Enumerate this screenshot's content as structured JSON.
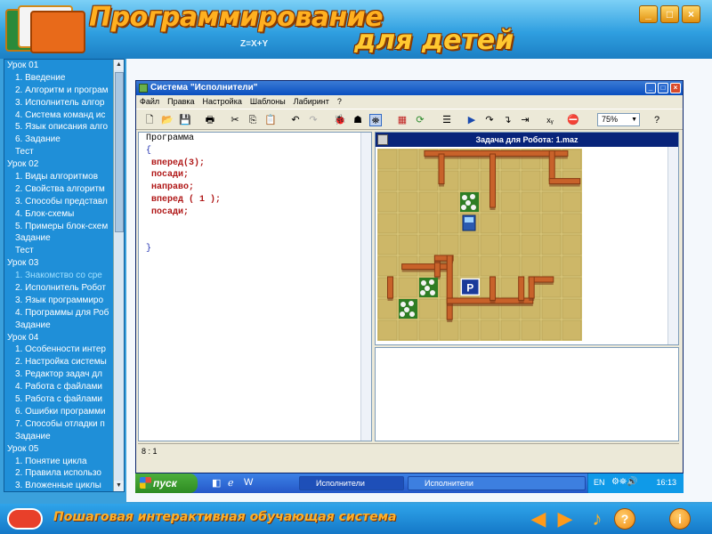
{
  "app": {
    "title_main": "Программирование",
    "title_sub": "для детей",
    "header_decor_formula": "Z=X+Y",
    "window_controls": {
      "minimize": "_",
      "maximize": "□",
      "close": "×"
    },
    "footer_text": "Пошаговая интерактивная обучающая система",
    "footer_buttons": {
      "back": "◀",
      "forward": "▶",
      "music": "♪",
      "help": "?",
      "info": "i"
    }
  },
  "lessons": [
    {
      "label": "Урок 01",
      "level": "h"
    },
    {
      "label": "1. Введение",
      "level": "s"
    },
    {
      "label": "2. Алгоритм и програм",
      "level": "s"
    },
    {
      "label": "3. Исполнитель алгор",
      "level": "s"
    },
    {
      "label": "4. Система команд ис",
      "level": "s"
    },
    {
      "label": "5. Язык описания алго",
      "level": "s"
    },
    {
      "label": "6. Задание",
      "level": "s"
    },
    {
      "label": "Тест",
      "level": "s"
    },
    {
      "label": "Урок 02",
      "level": "h"
    },
    {
      "label": "1. Виды алгоритмов",
      "level": "s"
    },
    {
      "label": "2. Свойства алгоритм",
      "level": "s"
    },
    {
      "label": "3. Способы представл",
      "level": "s"
    },
    {
      "label": "4. Блок-схемы",
      "level": "s"
    },
    {
      "label": "5. Примеры блок-схем",
      "level": "s"
    },
    {
      "label": "Задание",
      "level": "s"
    },
    {
      "label": "Тест",
      "level": "s"
    },
    {
      "label": "Урок 03",
      "level": "h"
    },
    {
      "label": "1. Знакомство со сре",
      "level": "s",
      "active": true
    },
    {
      "label": "2. Исполнитель Робот",
      "level": "s"
    },
    {
      "label": "3. Язык программиро",
      "level": "s"
    },
    {
      "label": "4. Программы для Роб",
      "level": "s"
    },
    {
      "label": "Задание",
      "level": "s"
    },
    {
      "label": "Урок 04",
      "level": "h"
    },
    {
      "label": "1. Особенности интер",
      "level": "s"
    },
    {
      "label": "2. Настройка системы",
      "level": "s"
    },
    {
      "label": "3. Редактор задач дл",
      "level": "s"
    },
    {
      "label": "4. Работа с файлами",
      "level": "s"
    },
    {
      "label": "5. Работа с файлами",
      "level": "s"
    },
    {
      "label": "6. Ошибки программи",
      "level": "s"
    },
    {
      "label": "7. Способы отладки п",
      "level": "s"
    },
    {
      "label": "Задание",
      "level": "s"
    },
    {
      "label": "Урок 05",
      "level": "h"
    },
    {
      "label": "1. Понятие цикла",
      "level": "s"
    },
    {
      "label": "2. Правила использо",
      "level": "s"
    },
    {
      "label": "3. Вложенные циклы",
      "level": "s"
    }
  ],
  "window": {
    "title": "Система \"Исполнители\"",
    "menu": [
      "Файл",
      "Правка",
      "Настройка",
      "Шаблоны",
      "Лабиринт",
      "?"
    ],
    "zoom": "75%",
    "robot_task_title": "Задача для Робота: 1.maz",
    "cursor_pos": "8 : 1",
    "program_lines": [
      {
        "text": "Программа",
        "kind": "plain"
      },
      {
        "text": "{",
        "kind": "sym"
      },
      {
        "text": " вперед(3);",
        "kind": "kw"
      },
      {
        "text": " посади;",
        "kind": "kw"
      },
      {
        "text": " направо;",
        "kind": "kw"
      },
      {
        "text": " вперед ( 1 );",
        "kind": "kw"
      },
      {
        "text": " посади;",
        "kind": "kw"
      },
      {
        "text": "",
        "kind": "plain"
      },
      {
        "text": "",
        "kind": "plain"
      },
      {
        "text": "}",
        "kind": "sym"
      }
    ],
    "maze_parking_label": "P"
  },
  "taskbar": {
    "start_label": "пуск",
    "tasks": [
      "Исполнители",
      "Исполнители"
    ],
    "lang": "EN",
    "clock": "16:13"
  },
  "colors": {
    "header_blue": "#2f9fe0",
    "title_orange": "#ffb020",
    "xp_title": "#0a4fc0",
    "keyword_red": "#b01818",
    "maze_floor": "#d8c67a",
    "wall_brick": "#c8622a"
  }
}
